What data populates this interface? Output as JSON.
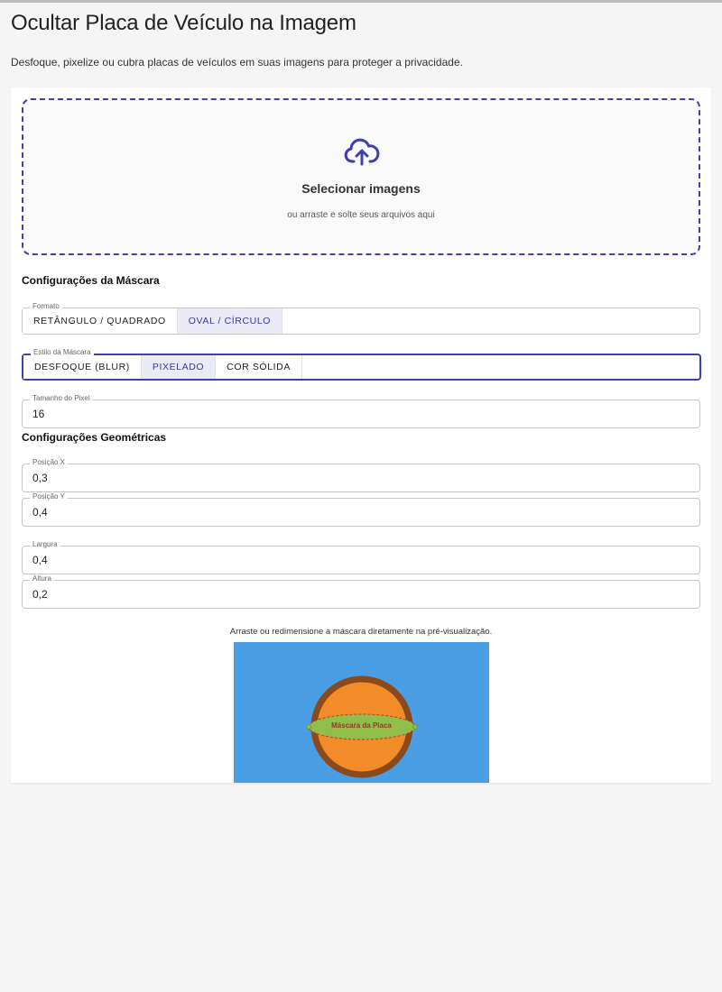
{
  "page": {
    "title": "Ocultar Placa de Veículo na Imagem",
    "subtitle": "Desfoque, pixelize ou cubra placas de veículos em suas imagens para proteger a privacidade."
  },
  "upload": {
    "icon": "cloud-upload-icon",
    "title": "Selecionar imagens",
    "hint": "ou arraste e solte seus arquivos aqui",
    "accent_color": "#3f3fb0"
  },
  "mask_settings": {
    "title": "Configurações da Máscara",
    "format": {
      "legend": "Formato",
      "options": [
        "RETÂNGULO / QUADRADO",
        "OVAL / CÍRCULO"
      ],
      "selected": "OVAL / CÍRCULO"
    },
    "style": {
      "legend": "Estilo da Máscara",
      "options": [
        "DESFOQUE (BLUR)",
        "PIXELADO",
        "COR SÓLIDA"
      ],
      "selected": "PIXELADO"
    },
    "pixel_size": {
      "legend": "Tamanho do Pixel",
      "value": "16"
    }
  },
  "geometry": {
    "title": "Configurações Geométricas",
    "pos_x": {
      "legend": "Posição X",
      "value": "0,3"
    },
    "pos_y": {
      "legend": "Posição Y",
      "value": "0,4"
    },
    "width": {
      "legend": "Largura",
      "value": "0,4"
    },
    "height": {
      "legend": "Altura",
      "value": "0,2"
    }
  },
  "preview": {
    "hint": "Arraste ou redimensione a máscara diretamente na pré-visualização.",
    "mask_label": "Máscara da Placa",
    "colors": {
      "background": "#4a9ee3",
      "ball_fill": "#f28c28",
      "ball_outline": "#8b4a1c",
      "mask_fill": "#8fbf4a"
    }
  }
}
